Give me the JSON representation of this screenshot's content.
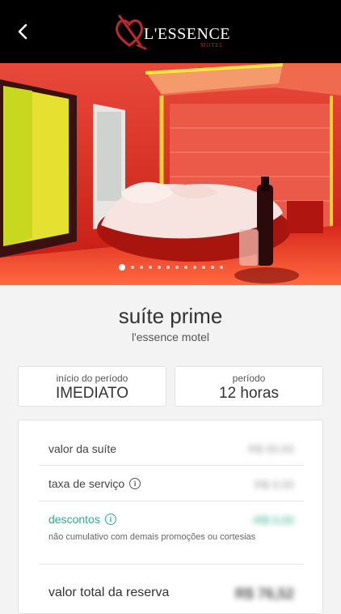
{
  "header": {
    "logo_text": "L'ESSENCE",
    "logo_sub": "MOTEL"
  },
  "gallery": {
    "slide_count": 12,
    "active_index": 0
  },
  "suite": {
    "name": "suíte prime",
    "motel": "l'essence motel"
  },
  "period_start": {
    "label": "início do período",
    "value": "IMEDIATO"
  },
  "period": {
    "label": "período",
    "value": "12 horas"
  },
  "pricing": {
    "suite_value_label": "valor da suíte",
    "suite_value": "R$ 00,00",
    "service_fee_label": "taxa de serviço",
    "service_fee": "R$ 0,00",
    "discounts_label": "descontos",
    "discounts": "-R$ 0,00",
    "discounts_note": "não cumulativo com demais promoções ou cortesias",
    "total_label": "valor total da reserva",
    "total": "R$ 76,52"
  },
  "colors": {
    "accent_green": "#2cae8c",
    "brand_red": "#c0272d",
    "header_bg": "#000000"
  }
}
